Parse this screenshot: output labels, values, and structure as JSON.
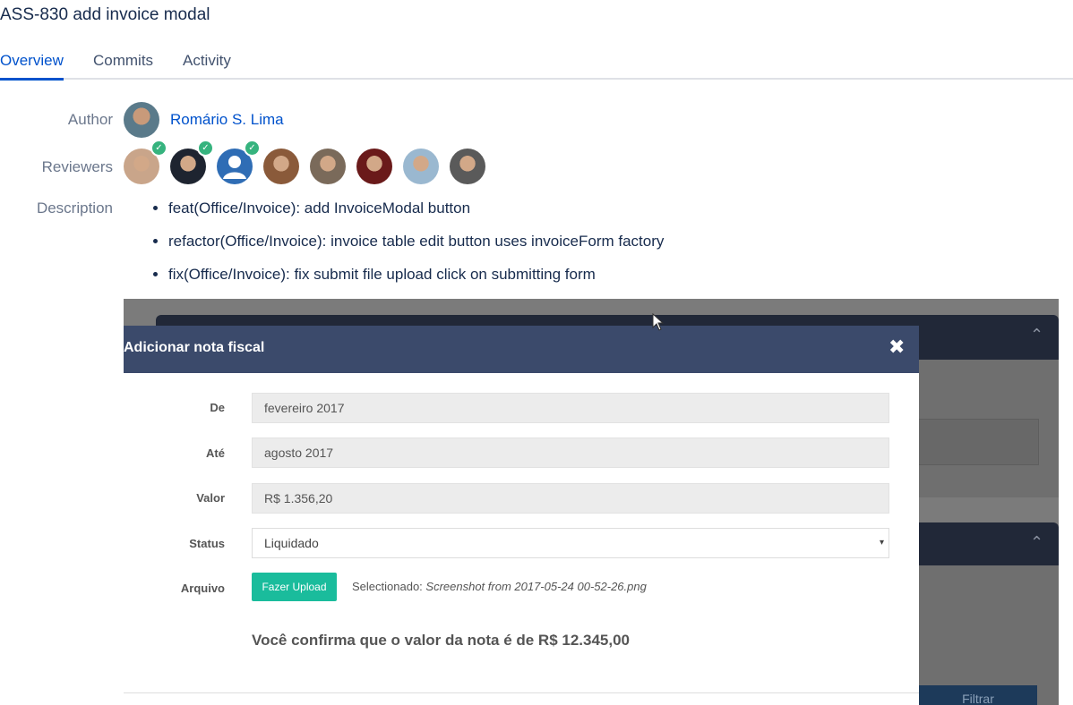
{
  "page": {
    "title": "ASS-830 add invoice modal"
  },
  "tabs": [
    {
      "label": "Overview",
      "active": true
    },
    {
      "label": "Commits",
      "active": false
    },
    {
      "label": "Activity",
      "active": false
    }
  ],
  "details": {
    "author_label": "Author",
    "author_name": "Romário S. Lima",
    "reviewers_label": "Reviewers",
    "description_label": "Description",
    "reviewers": [
      {
        "approved": true,
        "color": "#c9a58a"
      },
      {
        "approved": true,
        "color": "#1e2430"
      },
      {
        "approved": true,
        "color": "#2f6db5"
      },
      {
        "approved": false,
        "color": "#8a5a3a"
      },
      {
        "approved": false,
        "color": "#7a6a5a"
      },
      {
        "approved": false,
        "color": "#6a1a1a"
      },
      {
        "approved": false,
        "color": "#9ab8d0"
      },
      {
        "approved": false,
        "color": "#5a5a5a"
      }
    ],
    "description_items": [
      "feat(Office/Invoice): add InvoiceModal button",
      "refactor(Office/Invoice): invoice table edit button uses invoiceForm factory",
      "fix(Office/Invoice): fix submit file upload click on submitting form"
    ]
  },
  "embedded": {
    "modal_title": "Adicionar nota fiscal",
    "close_symbol": "✖",
    "fields": {
      "de_label": "De",
      "de_value": "fevereiro 2017",
      "ate_label": "Até",
      "ate_value": "agosto 2017",
      "valor_label": "Valor",
      "valor_value": "R$ 1.356,20",
      "status_label": "Status",
      "status_value": "Liquidado",
      "arquivo_label": "Arquivo"
    },
    "upload_button": "Fazer Upload",
    "selected_prefix": "Selectionado:",
    "selected_file": "Screenshot from 2017-05-24 00-52-26.png",
    "confirm_text": "Você confirma que o valor da nota é de R$ 12.345,00",
    "filter_button": "Filtrar"
  },
  "colors": {
    "link": "#0052cc",
    "modal_header": "#3b4a6b",
    "upload": "#1abc9c",
    "approved": "#36b37e"
  }
}
